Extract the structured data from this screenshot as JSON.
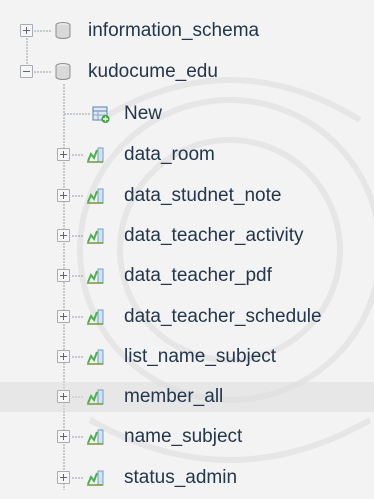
{
  "tree": {
    "databases": [
      {
        "name": "information_schema",
        "expanded": false
      },
      {
        "name": "kudocume_edu",
        "expanded": true
      }
    ],
    "new_label": "New",
    "tables": [
      "data_room",
      "data_studnet_note",
      "data_teacher_activity",
      "data_teacher_pdf",
      "data_teacher_schedule",
      "list_name_subject",
      "member_all",
      "name_subject",
      "status_admin"
    ],
    "highlighted_table": "member_all"
  },
  "icons": {
    "database": "database-icon",
    "new": "new-table-icon",
    "table": "table-icon"
  },
  "colors": {
    "text": "#23364d",
    "background": "#f3f3f3",
    "tree_line": "#9aa0a6"
  }
}
